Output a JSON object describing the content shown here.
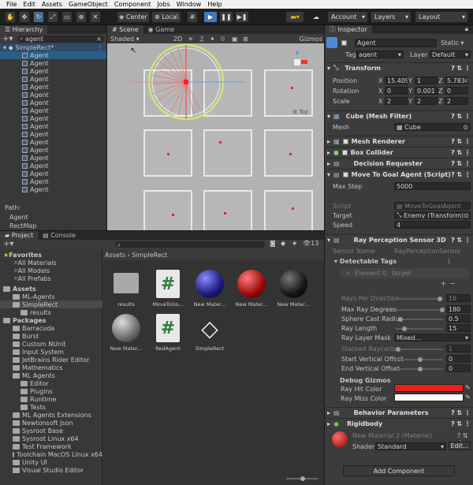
{
  "menubar": [
    "File",
    "Edit",
    "Assets",
    "GameObject",
    "Component",
    "Jobs",
    "Window",
    "Help"
  ],
  "toolbar": {
    "center": "Center",
    "local": "Local",
    "account": "Account",
    "layers": "Layers",
    "layout": "Layout"
  },
  "hierarchy": {
    "tab": "Hierarchy",
    "search": "agent",
    "scene": "SimpleRect*",
    "items": [
      "Agent",
      "Agent",
      "Agent",
      "Agent",
      "Agent",
      "Agent",
      "Agent",
      "Agent",
      "Agent",
      "Agent",
      "Agent",
      "Agent",
      "Agent",
      "Agent",
      "Agent",
      "Agent",
      "Agent",
      "Agent"
    ],
    "path_label": "Path:",
    "path": [
      "Agent",
      "RectMap"
    ]
  },
  "scene": {
    "tab_scene": "Scene",
    "tab_game": "Game",
    "shading": "Shaded",
    "mode2d": "2D",
    "gizmos": "Gizmos",
    "top_label": "Top"
  },
  "inspector": {
    "tab": "Inspector",
    "name": "Agent",
    "static": "Static",
    "tag_label": "Tag",
    "tag": "agent",
    "layer_label": "Layer",
    "layer": "Default",
    "transform": {
      "title": "Transform",
      "position": "Position",
      "rotation": "Rotation",
      "scale": "Scale",
      "pos": [
        "15.4098",
        "1",
        "5.78343"
      ],
      "rot": [
        "0",
        "0.001",
        "0"
      ],
      "scl": [
        "2",
        "2",
        "2"
      ]
    },
    "mesh_filter": {
      "title": "Cube (Mesh Filter)",
      "mesh_label": "Mesh",
      "mesh": "Cube"
    },
    "mesh_renderer": "Mesh Renderer",
    "box_collider": "Box Collider",
    "decision_requester": "Decision Requester",
    "move_to_goal": {
      "title": "Move To Goal Agent (Script)",
      "max_step_label": "Max Step",
      "max_step": "5000",
      "script_label": "Script",
      "script": "MoveToGoalAgent",
      "target_label": "Target",
      "target": "Enemy (Transform)",
      "speed_label": "Speed",
      "speed": "4"
    },
    "ray": {
      "title": "Ray Perception Sensor 3D",
      "sensor_name_label": "Sensor Name",
      "sensor_name": "RayPerceptionSensor",
      "detectable_tags": "Detectable Tags",
      "tags_count": "1",
      "element0": "Element 0",
      "element0_value": "target",
      "rays_per_dir": "Rays Per Direction",
      "rays_per_dir_val": "16",
      "max_ray_deg": "Max Ray Degrees",
      "max_ray_deg_val": "180",
      "sphere_cast": "Sphere Cast Radiu",
      "sphere_cast_val": "0.5",
      "ray_length": "Ray Length",
      "ray_length_val": "15",
      "ray_layer_mask": "Ray Layer Mask",
      "ray_layer_mask_val": "Mixed...",
      "stacked": "Stacked Raycasts",
      "stacked_val": "1",
      "start_offset": "Start Vertical Offset",
      "start_offset_val": "0",
      "end_offset": "End Vertical Offset",
      "end_offset_val": "0",
      "debug": "Debug Gizmos",
      "hit_color_label": "Ray Hit Color",
      "miss_color_label": "Ray Miss Color",
      "hit_color": "#e8201a",
      "miss_color": "#ffffff"
    },
    "behavior": "Behavior Parameters",
    "rigidbody": "Rigidbody",
    "material": {
      "name": "New Material 2 (Material)",
      "shader_label": "Shader",
      "shader": "Standard",
      "edit": "Edit..."
    },
    "add_component": "Add Component"
  },
  "project": {
    "tab_project": "Project",
    "tab_console": "Console",
    "count": "13",
    "breadcrumb": [
      "Assets",
      "SimpleRect"
    ],
    "favorites": "Favorites",
    "fav_items": [
      "All Materials",
      "All Models",
      "All Prefabs"
    ],
    "assets_root": "Assets",
    "assets_items": [
      "ML-Agents",
      "SimpleRect",
      "results"
    ],
    "packages_root": "Packages",
    "packages_items": [
      "Barracuda",
      "Burst",
      "Custom NUnit",
      "Input System",
      "JetBrains Rider Editor",
      "Mathematics",
      "ML Agents",
      "Editor",
      "Plugins",
      "Runtime",
      "Tests",
      "ML Agents Extensions",
      "Newtonsoft Json",
      "Sysroot Base",
      "Sysroot Linux x64",
      "Test Framework",
      "Toolchain MacOS Linux x64",
      "Unity UI",
      "Visual Studio Editor"
    ],
    "assets": [
      {
        "label": "results",
        "kind": "folder"
      },
      {
        "label": "MoveToGo...",
        "kind": "script"
      },
      {
        "label": "New Mater...",
        "kind": "blue"
      },
      {
        "label": "New Mater...",
        "kind": "red"
      },
      {
        "label": "New Mater...",
        "kind": "black"
      },
      {
        "label": "New Mater...",
        "kind": "grey"
      },
      {
        "label": "RedAgent",
        "kind": "script"
      },
      {
        "label": "SimpleRect",
        "kind": "unity"
      }
    ]
  }
}
